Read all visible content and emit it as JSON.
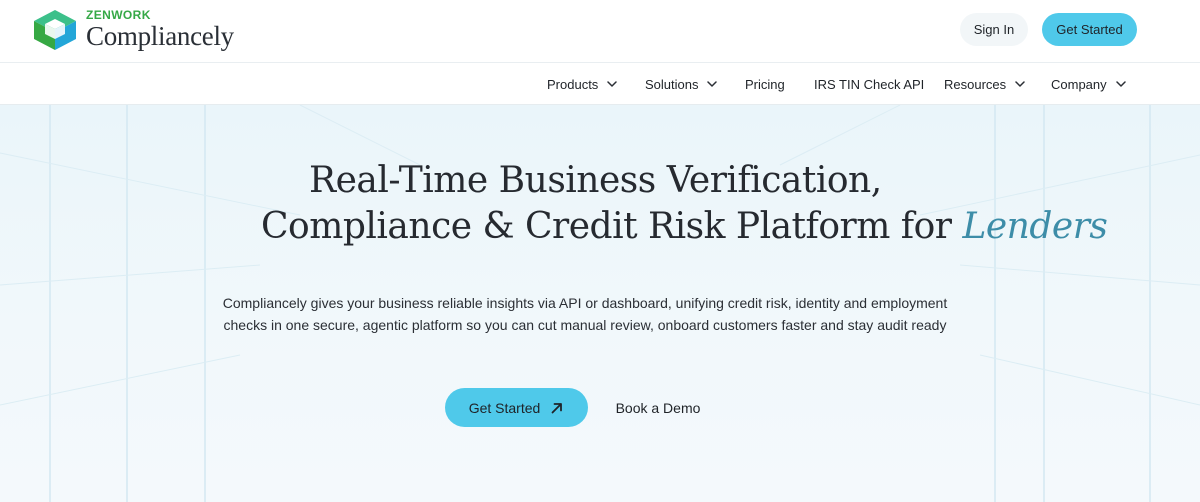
{
  "header": {
    "brand": "ZENWORK",
    "product": "Compliancely",
    "signin_label": "Sign In",
    "get_started_label": "Get Started"
  },
  "nav": {
    "items": [
      {
        "label": "Products",
        "dropdown": true
      },
      {
        "label": "Solutions",
        "dropdown": true
      },
      {
        "label": "Pricing",
        "dropdown": false
      },
      {
        "label": "IRS TIN Check API",
        "dropdown": false
      },
      {
        "label": "Resources",
        "dropdown": true
      },
      {
        "label": "Company",
        "dropdown": true
      }
    ]
  },
  "hero": {
    "headline_line1": "Real-Time Business Verification,",
    "headline_line2_prefix": "Compliance & Credit Risk Platform for ",
    "headline_accent": "Lenders",
    "subtext": "Compliancely gives your business reliable insights via API or dashboard, unifying credit risk, identity and employment checks in one secure, agentic platform so you can cut manual review, onboard customers faster and stay audit ready",
    "primary_cta": "Get Started",
    "secondary_cta": "Book a Demo"
  },
  "icons": {
    "logo": "zenwork-cube-logo",
    "dropdown": "chevron-down-icon",
    "cta_arrow": "arrow-up-right-icon"
  },
  "colors": {
    "accent_button": "#4fc9ea",
    "brand_green": "#35a846",
    "headline_accent": "#3d8da8",
    "hero_background": "#eaf5fa"
  }
}
